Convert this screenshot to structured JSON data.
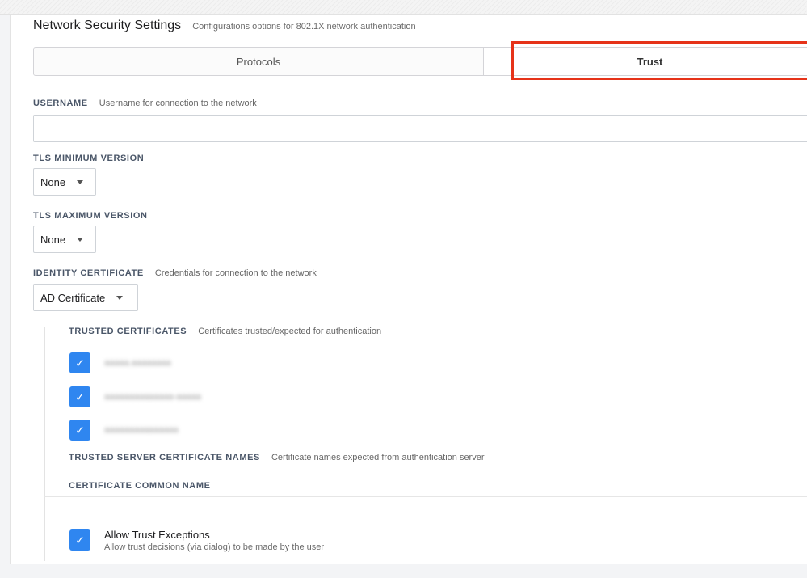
{
  "header": {
    "title": "Network Security Settings",
    "subtitle": "Configurations options for 802.1X network authentication"
  },
  "tabs": [
    {
      "label": "Protocols",
      "active": false
    },
    {
      "label": "Trust",
      "active": true
    }
  ],
  "highlight_color": "#e63319",
  "username": {
    "label": "USERNAME",
    "description": "Username for connection to the network",
    "value": ""
  },
  "tls_min": {
    "label": "TLS MINIMUM VERSION",
    "selected": "None"
  },
  "tls_max": {
    "label": "TLS MAXIMUM VERSION",
    "selected": "None"
  },
  "identity_certificate": {
    "label": "IDENTITY CERTIFICATE",
    "description": "Credentials for connection to the network",
    "selected": "AD Certificate"
  },
  "trusted_certificates": {
    "label": "TRUSTED CERTIFICATES",
    "description": "Certificates trusted/expected for authentication",
    "items": [
      {
        "name": "aaaaa.aaaaaaaa",
        "checked": true
      },
      {
        "name": "aaaaaaaaaaaaaa-aaaaa",
        "checked": true
      },
      {
        "name": "aaaaaaaaaaaaaaa",
        "checked": true
      }
    ]
  },
  "trusted_server_names": {
    "label": "TRUSTED SERVER CERTIFICATE NAMES",
    "description": "Certificate names expected from authentication server"
  },
  "common_name": {
    "label": "CERTIFICATE COMMON NAME"
  },
  "allow_trust_exceptions": {
    "title": "Allow Trust Exceptions",
    "description": "Allow trust decisions (via dialog) to be made by the user",
    "checked": true
  },
  "checkbox_color": "#2f86f0",
  "check_glyph": "✓"
}
